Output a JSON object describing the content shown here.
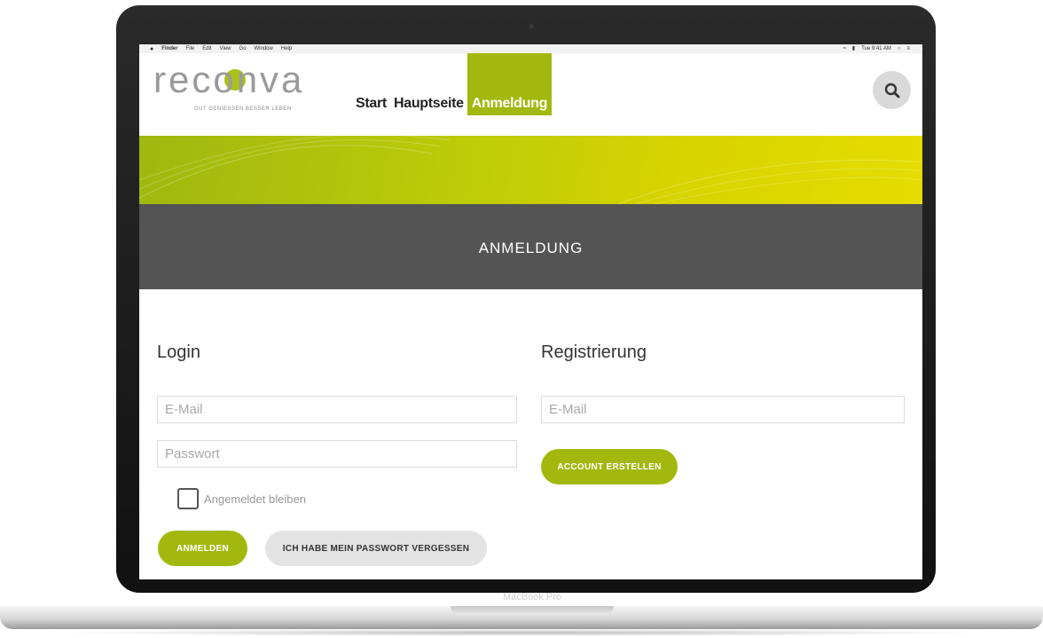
{
  "menubar": {
    "apple": "",
    "items": [
      "Finder",
      "File",
      "Edit",
      "View",
      "Go",
      "Window",
      "Help"
    ],
    "clock": "Tue 9:41 AM"
  },
  "logo": {
    "word": "reconva",
    "tagline": "GUT GENIESSEN BESSER LEBEN"
  },
  "nav": {
    "items": [
      {
        "label": "Start"
      },
      {
        "label": "Hauptseite"
      },
      {
        "label": "Anmeldung"
      }
    ]
  },
  "page": {
    "title": "ANMELDUNG"
  },
  "login": {
    "title": "Login",
    "email_placeholder": "E-Mail",
    "password_placeholder": "Passwort",
    "remember_label": "Angemeldet bleiben",
    "submit_label": "ANMELDEN",
    "forgot_label": "ICH HABE MEIN PASSWORT VERGESSEN"
  },
  "register": {
    "title": "Registrierung",
    "email_placeholder": "E-Mail",
    "submit_label": "ACCOUNT ERSTELLEN"
  },
  "device": {
    "label": "MacBook Pro"
  },
  "colors": {
    "accent": "#a3b80e",
    "band": "#545454"
  }
}
